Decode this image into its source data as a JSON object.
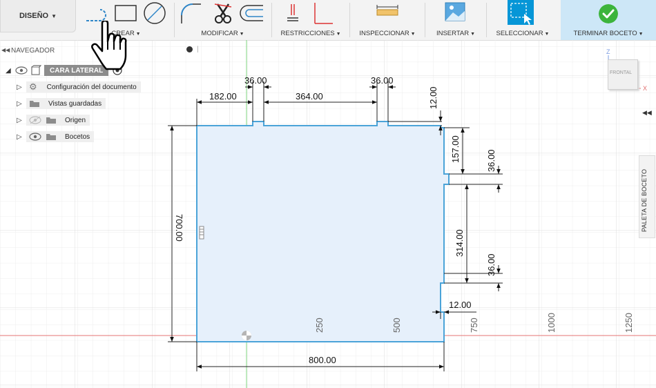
{
  "toolbar": {
    "design_label": "DISEÑO",
    "groups": [
      {
        "label": "CREAR"
      },
      {
        "label": "MODIFICAR"
      },
      {
        "label": "RESTRICCIONES"
      },
      {
        "label": "INSPECCIONAR"
      },
      {
        "label": "INSERTAR"
      },
      {
        "label": "SELECCIONAR"
      }
    ],
    "finish_label": "TERMINAR BOCETO"
  },
  "navigator": {
    "title": "NAVEGADOR",
    "root": "CARA LATERAL",
    "items": [
      {
        "label": "Configuración del documento",
        "icon": "gear-icon"
      },
      {
        "label": "Vistas guardadas",
        "icon": "folder-icon"
      },
      {
        "label": "Origen",
        "icon": "folder-icon"
      },
      {
        "label": "Bocetos",
        "icon": "folder-icon"
      }
    ]
  },
  "viewcube": {
    "face": "FRONTAL",
    "axis_z": "Z",
    "axis_x": "X"
  },
  "sketch_palette": {
    "label": "PALETA DE BOCETO"
  },
  "dimensions": {
    "d_36_a": "36.00",
    "d_36_b": "36.00",
    "d_182": "182.00",
    "d_364": "364.00",
    "d_12_top": "12.00",
    "d_157": "157.00",
    "d_36_right_a": "36.00",
    "d_314": "314.00",
    "d_36_right_b": "36.00",
    "d_12_bottom": "12.00",
    "d_700": "700.00",
    "d_800": "800.00"
  },
  "axis_ticks": [
    "250",
    "500",
    "750",
    "1000",
    "1250"
  ],
  "colors": {
    "profile_fill": "#e6f0fb",
    "profile_stroke": "#4aa3d8",
    "x_axis": "#e57373",
    "y_axis": "#7fd67f",
    "grid": "#e4e4e4",
    "finish_bg": "#cde7f7",
    "accent_blue": "#0696d7"
  }
}
